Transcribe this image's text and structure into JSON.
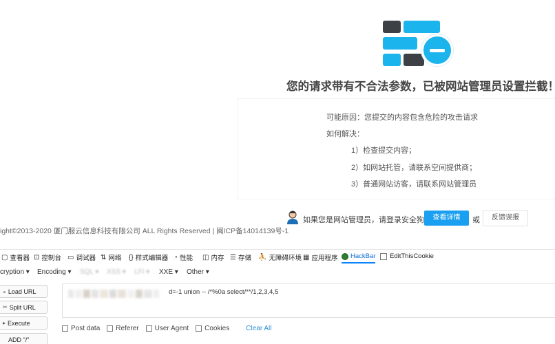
{
  "block_page": {
    "title": "您的请求带有不合法参数，已被网站管理员设置拦截！",
    "reason_label": "可能原因：您提交的内容包含危险的攻击请求",
    "solution_label": "如何解决：",
    "solutions": [
      "1）检查提交内容；",
      "2）如网站托管，请联系空间提供商；",
      "3）普通网站访客，请联系网站管理员"
    ],
    "admin_prompt": "如果您是网站管理员，请登录安全狗",
    "detail_button": "查看详情",
    "or_text": "或",
    "feedback_button": "反馈误报",
    "copyright": "ight©2013-2020 厦门服云信息科技有限公司 ALL Rights Reserved | 闽ICP备14014139号-1",
    "colors": {
      "accent": "#1bb4ec",
      "button": "#1b9ff0",
      "dark_brick": "#3d4044"
    }
  },
  "devtools": {
    "tabs": [
      {
        "icon": "inspector-icon",
        "glyph": "▢",
        "label": "查看器"
      },
      {
        "icon": "console-icon",
        "glyph": "⊡",
        "label": "控制台"
      },
      {
        "icon": "debugger-icon",
        "glyph": "▭",
        "label": "调试器"
      },
      {
        "icon": "network-icon",
        "glyph": "⇅",
        "label": "网络"
      },
      {
        "icon": "style-editor-icon",
        "glyph": "{}",
        "label": "样式编辑器"
      },
      {
        "icon": "performance-icon",
        "glyph": "◔",
        "label": "性能"
      },
      {
        "icon": "memory-icon",
        "glyph": "◫",
        "label": "内存"
      },
      {
        "icon": "storage-icon",
        "glyph": "☰",
        "label": "存储"
      },
      {
        "icon": "accessibility-icon",
        "glyph": "⛹",
        "label": "无障碍环境"
      },
      {
        "icon": "application-icon",
        "glyph": "▦",
        "label": "应用程序"
      },
      {
        "icon": "hackbar-icon",
        "glyph": "",
        "label": "HackBar"
      },
      {
        "icon": "editthiscookie-icon",
        "glyph": "",
        "label": "EditThisCookie"
      }
    ]
  },
  "hackbar": {
    "menu": [
      "cryption ▾",
      "Encoding ▾",
      "SQL ▾",
      "XSS ▾",
      "LFI ▾",
      "XXE ▾",
      "Other ▾"
    ],
    "buttons": [
      {
        "icon": "load-url-icon",
        "glyph": "◒",
        "label": "Load URL"
      },
      {
        "icon": "split-url-icon",
        "glyph": "✂",
        "label": "Split URL"
      },
      {
        "icon": "execute-icon",
        "glyph": "▸",
        "label": "Execute"
      },
      {
        "icon": "",
        "glyph": "",
        "label": "ADD \"/\""
      }
    ],
    "url_visible": "d=-1 union -- /*%0a select/**/1,2,3,4,5",
    "options": [
      "Post data",
      "Referer",
      "User Agent",
      "Cookies"
    ],
    "clear_all": "Clear All"
  }
}
